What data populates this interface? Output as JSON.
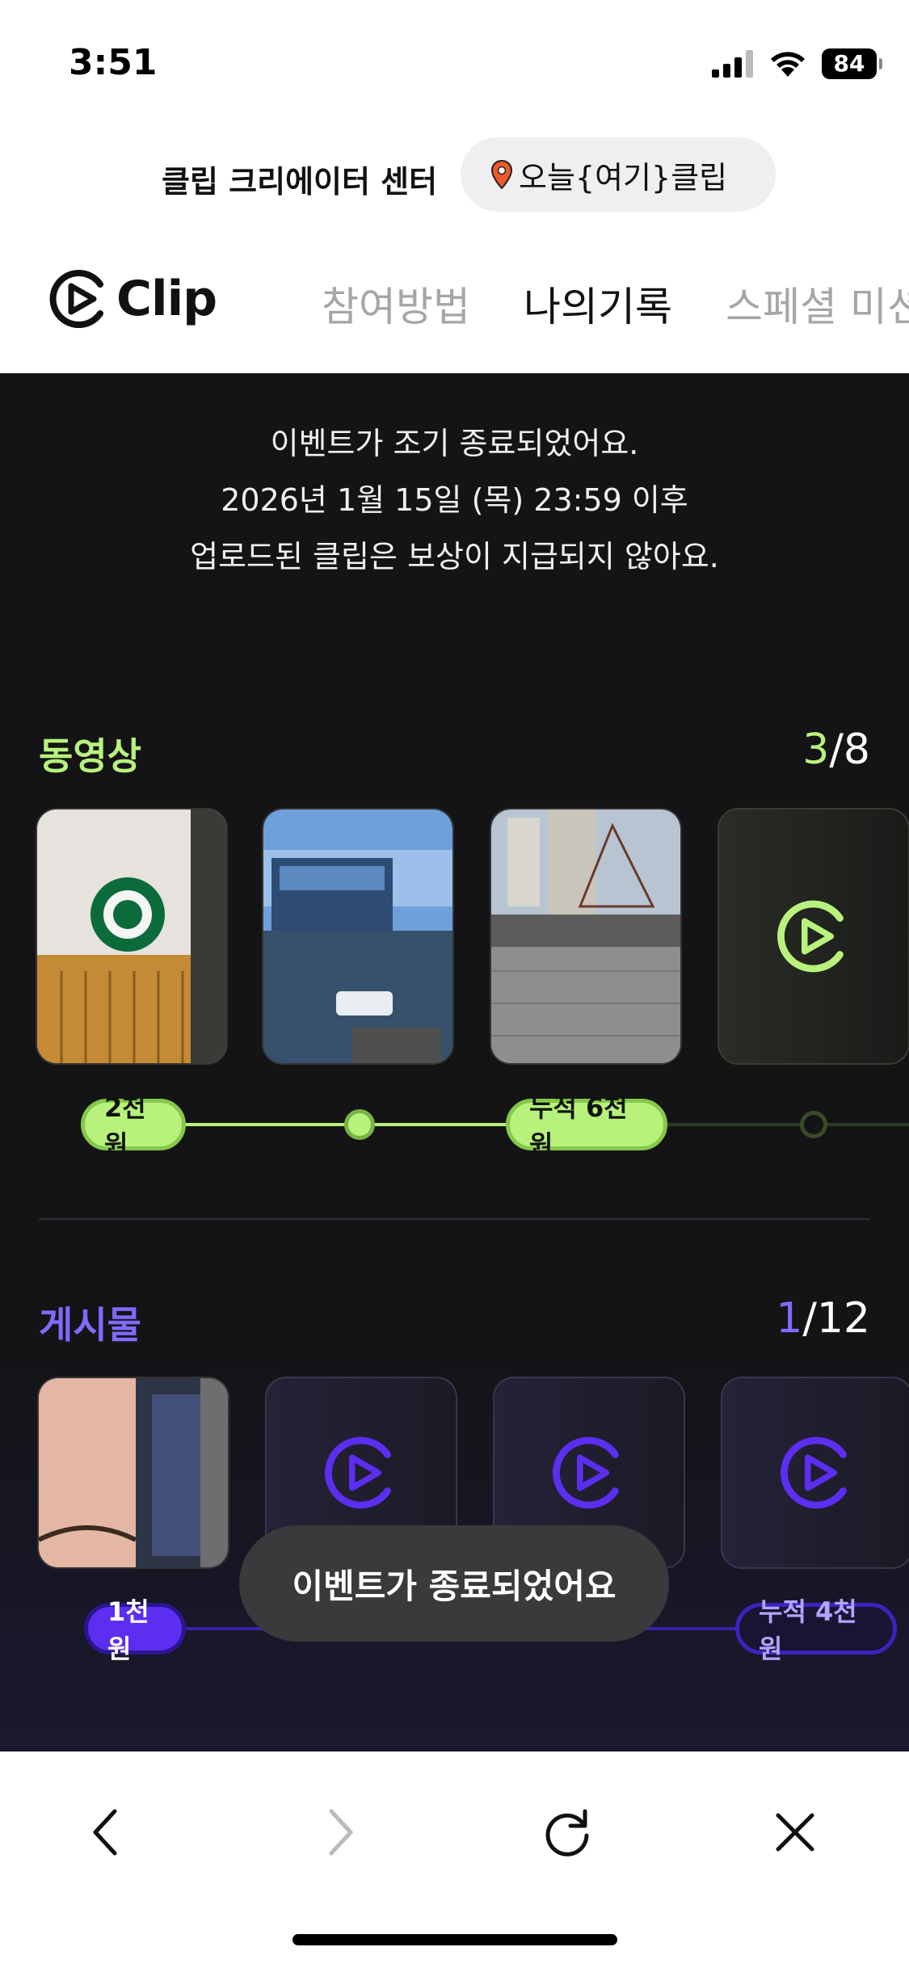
{
  "status": {
    "time": "3:51",
    "battery": "84"
  },
  "header": {
    "creator_center": "클립 크리에이터 센터",
    "today_chip": "오늘{여기}클립"
  },
  "nav": {
    "logo": "Clip",
    "tabs": [
      {
        "label": "참여방법"
      },
      {
        "label": "나의기록"
      },
      {
        "label": "스페셜 미션"
      }
    ]
  },
  "notice": {
    "line1": "이벤트가 조기 종료되었어요.",
    "line2": "2026년 1월 15일 (목) 23:59 이후",
    "line3": "업로드된 클립은 보상이 지급되지 않아요."
  },
  "video_section": {
    "title": "동영상",
    "count_done": "3",
    "count_total": "/8",
    "reward_first": "2천원",
    "reward_cumulative": "누적 6천원",
    "accent_color": "#b8f27c"
  },
  "post_section": {
    "title": "게시물",
    "count_done": "1",
    "count_total": "/12",
    "reward_first": "1천원",
    "reward_cumulative": "누적 4천원",
    "accent_color": "#7f6bff"
  },
  "toast": {
    "message": "이벤트가 종료되었어요"
  },
  "bottom_bar": {
    "back": "chevron-left-icon",
    "forward": "chevron-right-icon",
    "reload": "reload-icon",
    "close": "close-icon"
  }
}
